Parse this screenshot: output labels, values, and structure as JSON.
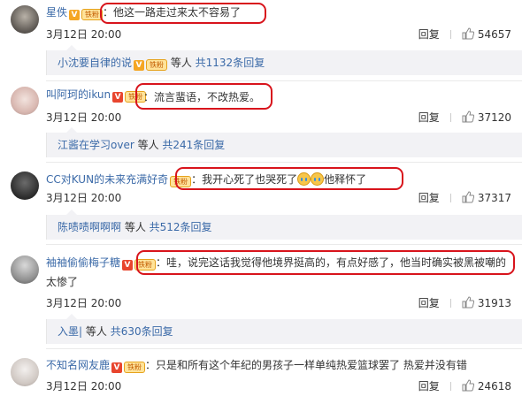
{
  "comments": [
    {
      "username": "星佚",
      "badge_letter": "V",
      "fan_label": "铁粉",
      "text": "：他这一路走过来太不容易了",
      "time": "3月12日 20:00",
      "reply_label": "回复",
      "likes": "54657",
      "thread": {
        "first_replier": "小沈要自律的说",
        "middle": " 等人 ",
        "total": "共1132条回复"
      }
    },
    {
      "username": "叫阿珂的ikun",
      "badge_letter": "V",
      "fan_label": "铁粉",
      "text": "：流言蜚语，不改热爱。",
      "time": "3月12日 20:00",
      "reply_label": "回复",
      "likes": "37120",
      "thread": {
        "first_replier": "江酱在学习over",
        "middle": " 等人 ",
        "total": "共241条回复"
      }
    },
    {
      "username": "CC对KUN的未来充满好奇",
      "fan_label": "铁粉",
      "text_a": "：我开心死了也哭死了",
      "text_b": "他释怀了",
      "emoji_name": "tears-of-joy-emoji",
      "time": "3月12日 20:00",
      "reply_label": "回复",
      "likes": "37317",
      "thread": {
        "first_replier": "陈啧啧啊啊啊",
        "middle": " 等人 ",
        "total": "共512条回复"
      }
    },
    {
      "username": "袖袖偷偷梅子糖",
      "badge_letter": "V",
      "fan_label": "铁粉",
      "text_a": "：哇，说完这话我觉得他境界挺高的，有点好感了，他当时确实被黑被嘲的",
      "text_b": "太惨了",
      "time": "3月12日 20:00",
      "reply_label": "回复",
      "likes": "31913",
      "thread": {
        "first_replier": "入墨|",
        "middle": " 等人 ",
        "total": "共630条回复"
      }
    },
    {
      "username": "不知名网友鹿",
      "badge_letter": "V",
      "fan_label": "铁粉",
      "text": "：只是和所有这个年纪的男孩子一样单纯热爱篮球罢了 热爱并没有错",
      "time": "3月12日 20:00",
      "reply_label": "回复",
      "likes": "24618"
    }
  ],
  "colors": {
    "highlight": "#d8141c",
    "link": "#3b6aa8",
    "name_orange": "#eb7350",
    "reply_bg": "#f2f2f5"
  }
}
